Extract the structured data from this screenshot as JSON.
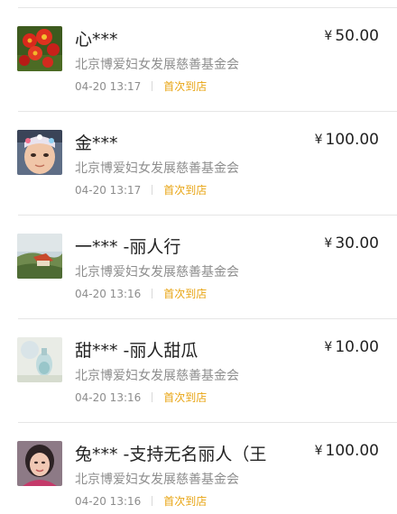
{
  "donations": [
    {
      "name": "心***",
      "currency": "¥",
      "amount": "50.00",
      "org": "北京博爱妇女发展慈善基金会",
      "time": "04-20 13:17",
      "tag": "首次到店",
      "avatar": "red-flowers-photo"
    },
    {
      "name": "金***",
      "currency": "¥",
      "amount": "100.00",
      "org": "北京博爱妇女发展慈善基金会",
      "time": "04-20 13:17",
      "tag": "首次到店",
      "avatar": "child-portrait-photo"
    },
    {
      "name": "一*** -丽人行",
      "currency": "¥",
      "amount": "30.00",
      "org": "北京博爱妇女发展慈善基金会",
      "time": "04-20 13:16",
      "tag": "首次到店",
      "avatar": "landscape-house-photo"
    },
    {
      "name": "甜*** -丽人甜瓜",
      "currency": "¥",
      "amount": "10.00",
      "org": "北京博爱妇女发展慈善基金会",
      "time": "04-20 13:16",
      "tag": "首次到店",
      "avatar": "glass-bottle-photo"
    },
    {
      "name": "兔*** -支持无名丽人（王",
      "currency": "¥",
      "amount": "100.00",
      "org": "北京博爱妇女发展慈善基金会",
      "time": "04-20 13:16",
      "tag": "首次到店",
      "avatar": "woman-portrait-photo"
    }
  ],
  "colors": {
    "tag": "#e8a412",
    "secondary_text": "#8d8d8d",
    "primary_text": "#222222",
    "divider": "#e6e6e6"
  }
}
